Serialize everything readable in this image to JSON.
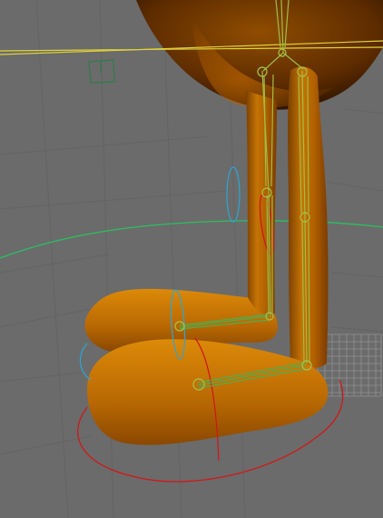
{
  "viewport": {
    "background_color": "#6b6b6b",
    "grid_color": "#5e5e5e",
    "floor_grid_color": "#9a9a9a"
  },
  "character": {
    "body_color": "#8a4a00",
    "leg_color": "#b86b00",
    "foot_color": "#c97a06"
  },
  "rig": {
    "joint_color": "#a8c34a",
    "bone_color": "#9fbe43",
    "ik_handle_color": "#4caf50",
    "control_blue": "#2aa6d6",
    "control_red": "#d01818",
    "selection_yellow": "#e0d23a",
    "horizon_green": "#2ac060",
    "locator_green": "#2f7b4b"
  }
}
